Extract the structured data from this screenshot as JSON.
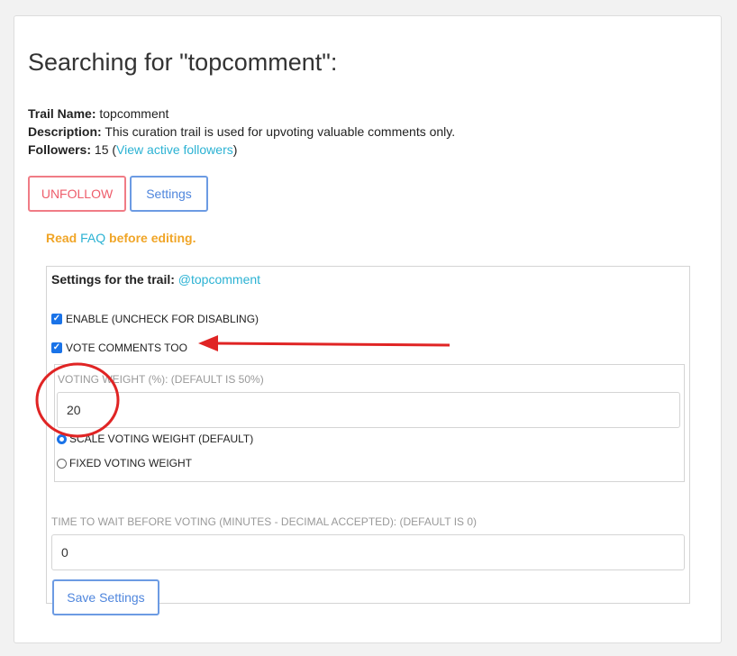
{
  "page": {
    "title": "Searching for \"topcomment\":"
  },
  "trail_info": {
    "name_label": "Trail Name:",
    "name_value": "topcomment",
    "description_label": "Description:",
    "description_value": "This curation trail is used for upvoting valuable comments only.",
    "followers_label": "Followers:",
    "followers_count": "15",
    "followers_open": "(",
    "followers_link": "View active followers",
    "followers_close": ")"
  },
  "buttons": {
    "unfollow": "UNFOLLOW",
    "settings": "Settings"
  },
  "faq": {
    "prefix": "Read",
    "link": "FAQ",
    "suffix": "before editing."
  },
  "settings_panel": {
    "title_label": "Settings for the trail:",
    "trail_link": "@topcomment",
    "enable": {
      "label": "ENABLE (UNCHECK FOR DISABLING)",
      "checked": true
    },
    "vote_comments": {
      "label": "VOTE COMMENTS TOO",
      "checked": true
    },
    "voting_weight": {
      "label": "VOTING WEIGHT (%): (DEFAULT IS 50%)",
      "value": "20"
    },
    "weight_mode": {
      "options": [
        "SCALE VOTING WEIGHT (DEFAULT)",
        "FIXED VOTING WEIGHT"
      ],
      "selected": "SCALE VOTING WEIGHT (DEFAULT)"
    },
    "wait_time": {
      "label": "TIME TO WAIT BEFORE VOTING (MINUTES - DECIMAL ACCEPTED): (DEFAULT IS 0)",
      "value": "0"
    },
    "save_label": "Save Settings"
  },
  "annotation": {
    "color": "#e02424",
    "shapes": [
      "arrow-pointing-left",
      "circle"
    ]
  }
}
